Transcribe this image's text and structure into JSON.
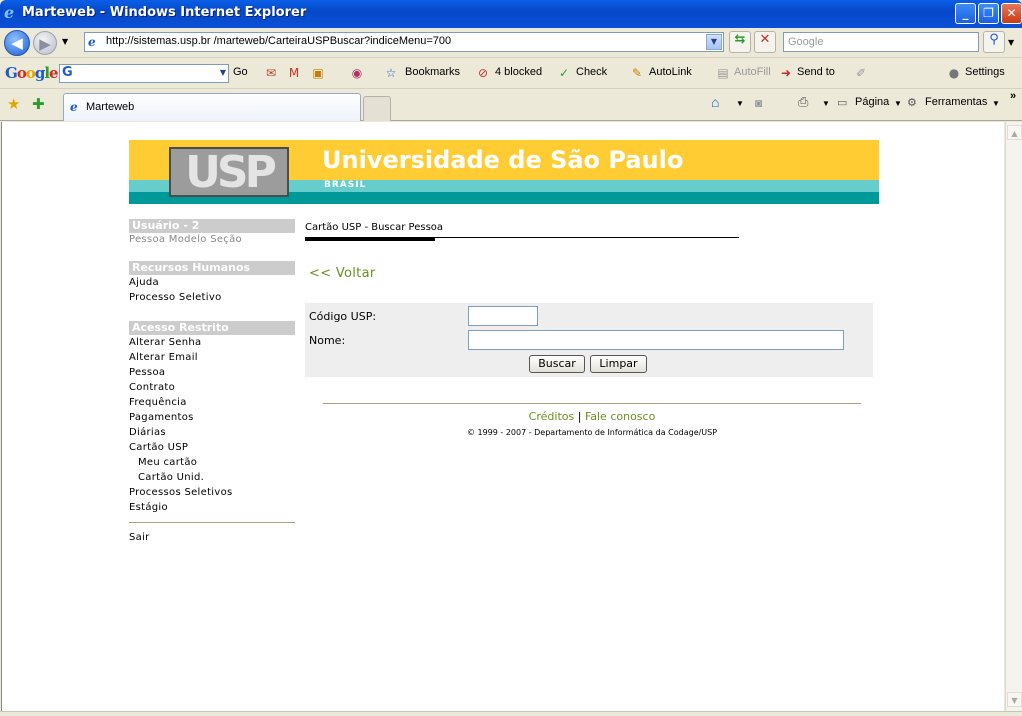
{
  "window": {
    "title": "Marteweb - Windows Internet Explorer",
    "minimize": "_",
    "maximize": "❐",
    "close": "✕"
  },
  "address_bar": {
    "url": "http://sistemas.usp.br /marteweb/CarteiraUSPBuscar?indiceMenu=700",
    "search_placeholder": "Google"
  },
  "google_toolbar": {
    "logo": "Google",
    "go": "Go",
    "bookmarks": "Bookmarks",
    "blocked": "4 blocked",
    "check": "Check",
    "autolink": "AutoLink",
    "autofill": "AutoFill",
    "send_to": "Send to",
    "settings": "Settings"
  },
  "tabs": [
    {
      "label": "Marteweb"
    }
  ],
  "command_bar": {
    "pagina": "Página",
    "ferramentas": "Ferramentas",
    "more": "»"
  },
  "banner": {
    "logo": "USP",
    "title": "Universidade de São Paulo",
    "subtitle": "BRASIL"
  },
  "sidebar": {
    "user_header": "Usuário - 2",
    "user_name": "Pessoa Modelo Seção",
    "rh_header": "Recursos Humanos",
    "rh_items": [
      "Ajuda",
      "Processo Seletivo"
    ],
    "acesso_header": "Acesso Restrito",
    "acesso_items": [
      "Alterar Senha",
      "Alterar Email",
      "Pessoa",
      "Contrato",
      "Frequência",
      "Pagamentos",
      "Diárias",
      "Cartão USP"
    ],
    "cartao_sub": [
      "Meu cartão",
      "Cartão Unid."
    ],
    "acesso_items_after": [
      "Processos Seletivos",
      "Estágio"
    ],
    "logout": "Sair"
  },
  "main": {
    "breadcrumb": "Cartão USP - Buscar Pessoa",
    "back_link": "<< Voltar",
    "form": {
      "codigo_label": "Código USP:",
      "codigo_value": "",
      "nome_label": "Nome:",
      "nome_value": "",
      "buscar": "Buscar",
      "limpar": "Limpar"
    },
    "footer": {
      "creditos": "Créditos",
      "separator": "|",
      "fale": "Fale conosco",
      "copyright": "© 1999 - 2007 - Departamento de Informática da Codage/USP"
    }
  },
  "colors": {
    "banner_yellow": "#ffcc33",
    "banner_teal_light": "#66cccc",
    "banner_teal_dark": "#009999",
    "link_green": "#6b8e23"
  }
}
